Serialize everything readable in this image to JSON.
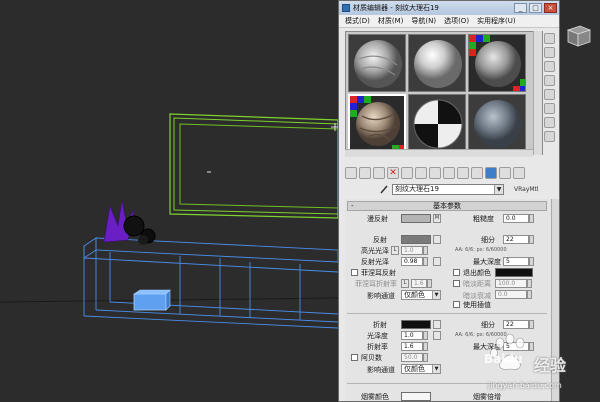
{
  "window": {
    "title": "材质编辑器 - 刻纹大理石19",
    "minimize": "_",
    "maximize": "□",
    "close": "×"
  },
  "menu": [
    "模式(D)",
    "材质(M)",
    "导航(N)",
    "选项(O)",
    "实用程序(U)"
  ],
  "material": {
    "name": "刻纹大理石19",
    "type": "VRayMtl"
  },
  "basic_params": {
    "title": "基本参数",
    "diffuse": {
      "label": "漫反射",
      "map_btn": "M"
    },
    "roughness": {
      "label": "粗糙度",
      "value": "0.0"
    },
    "reflection": {
      "label": "反射"
    },
    "subdivs": {
      "label": "细分",
      "value": "22"
    },
    "hilight_gloss": {
      "label": "高光光泽",
      "lock": "L",
      "value": "1.0"
    },
    "aa_hint": "AA: 6/6; px: 6/60000",
    "refl_gloss": {
      "label": "反射光泽",
      "value": "0.98"
    },
    "max_depth": {
      "label": "最大深度",
      "value": "5"
    },
    "fresnel": {
      "label": "菲涅耳反射"
    },
    "exit_color": {
      "label": "退出颜色"
    },
    "fresnel_ior": {
      "label": "菲涅耳折射率",
      "lock": "L",
      "value": "1.6"
    },
    "dim_distance": {
      "label": "暗淡距离",
      "value": "100.0"
    },
    "affect_channels": {
      "label": "影响通道",
      "value": "仅颜色"
    },
    "dim_falloff": {
      "label": "暗淡衰减",
      "value": "0.0"
    },
    "use_interp": {
      "label": "使用插值"
    }
  },
  "refraction_params": {
    "refraction": {
      "label": "折射"
    },
    "subdivs": {
      "label": "细分",
      "value": "22"
    },
    "gloss": {
      "label": "光泽度",
      "value": "1.0"
    },
    "aa_hint": "AA: 6/6; px: 6/60000",
    "ior": {
      "label": "折射率",
      "value": "1.6"
    },
    "max_depth": {
      "label": "最大深度",
      "value": "5"
    },
    "abbe": {
      "label": "阿贝数",
      "value": "50.0"
    },
    "affect_channels": {
      "label": "影响通道",
      "value": "仅颜色"
    },
    "fog_color": {
      "label": "烟雾颜色"
    },
    "fog_mult": {
      "label": "烟雾倍增"
    }
  },
  "watermark": {
    "brand": "经验",
    "baidu": "Baidu",
    "url": "jingyan.baidu.com"
  },
  "colors": {
    "viewport_bg": "#2c2c2c",
    "frame_green": "#7fd22e",
    "cabinet_blue": "#4a8de8",
    "vase_purple": "#6a1fc4"
  }
}
